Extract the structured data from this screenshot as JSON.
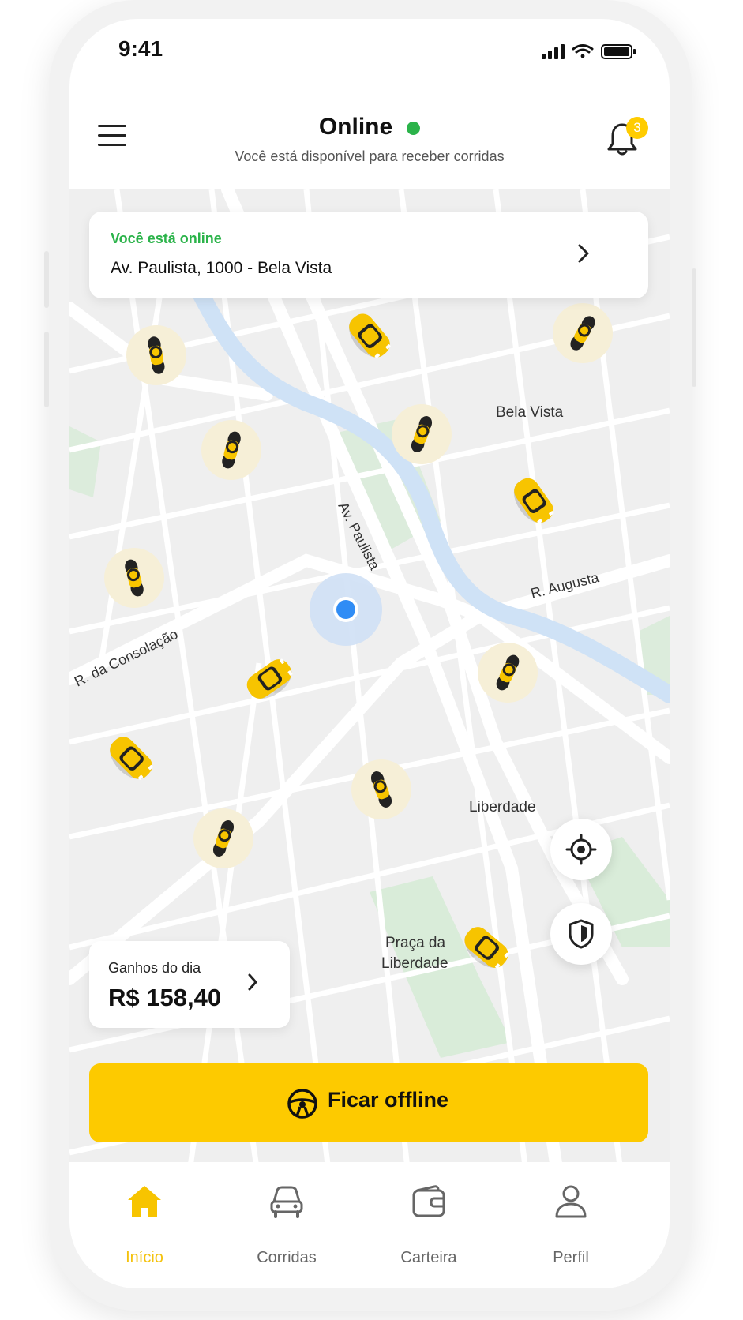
{
  "status_bar": {
    "time": "9:41"
  },
  "header": {
    "status_title": "Online",
    "subtitle": "Você está disponível para receber corridas",
    "notification_count": "3"
  },
  "location_card": {
    "status": "Você está online",
    "address": "Av. Paulista, 1000 - Bela Vista"
  },
  "map_labels": {
    "bela_vista": "Bela Vista",
    "av_paulista": "Av. Paulista",
    "r_augusta": "R. Augusta",
    "r_consolacao": "R. da Consolação",
    "liberdade": "Liberdade",
    "praca_line1": "Praça da",
    "praca_line2": "Liberdade"
  },
  "earnings": {
    "label": "Ganhos do dia",
    "value": "R$ 158,40"
  },
  "cta": {
    "label": "Ficar offline"
  },
  "tabs": [
    {
      "label": "Início",
      "icon": "home-icon",
      "active": true
    },
    {
      "label": "Corridas",
      "icon": "car-icon",
      "active": false
    },
    {
      "label": "Carteira",
      "icon": "wallet-icon",
      "active": false
    },
    {
      "label": "Perfil",
      "icon": "user-icon",
      "active": false
    }
  ],
  "colors": {
    "accent": "#fdca00",
    "online": "#2bb34a",
    "location": "#2f8cf5",
    "river": "#cfe3f7",
    "park": "#d9ecd9"
  }
}
